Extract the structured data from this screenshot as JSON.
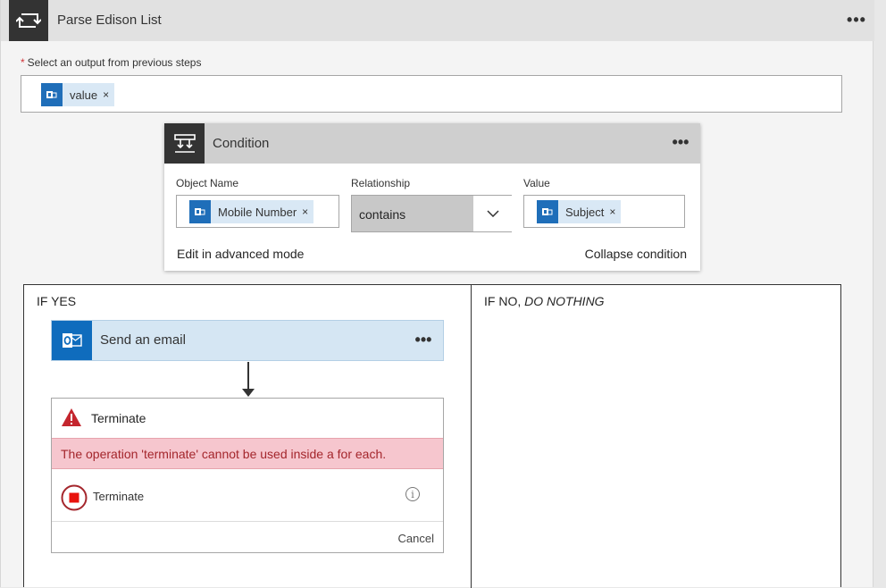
{
  "foreach": {
    "title": "Parse Edison List",
    "more": "•••"
  },
  "select": {
    "required_mark": "*",
    "label": "Select an output from previous steps",
    "token": {
      "text": "value",
      "remove": "×"
    }
  },
  "condition": {
    "title": "Condition",
    "more": "•••",
    "object_name": {
      "label": "Object Name",
      "token": {
        "text": "Mobile Number",
        "remove": "×"
      }
    },
    "relationship": {
      "label": "Relationship",
      "value": "contains"
    },
    "value": {
      "label": "Value",
      "token": {
        "text": "Subject",
        "remove": "×"
      }
    },
    "advanced_link": "Edit in advanced mode",
    "collapse_link": "Collapse condition"
  },
  "branches": {
    "if_yes_label": "IF YES",
    "if_no_prefix": "IF NO, ",
    "if_no_emphasis": "DO NOTHING",
    "email": {
      "title": "Send an email",
      "more": "•••"
    },
    "terminate": {
      "title": "Terminate",
      "error": "The operation 'terminate' cannot be used inside a for each.",
      "row_label": "Terminate",
      "info": "i",
      "cancel": "Cancel"
    }
  },
  "colors": {
    "brand_blue": "#0f6cbd",
    "token_bg": "#d9e8f5",
    "error_bg": "#f6c6ce",
    "error_text": "#a4262c",
    "warning_red": "#c4262e"
  }
}
